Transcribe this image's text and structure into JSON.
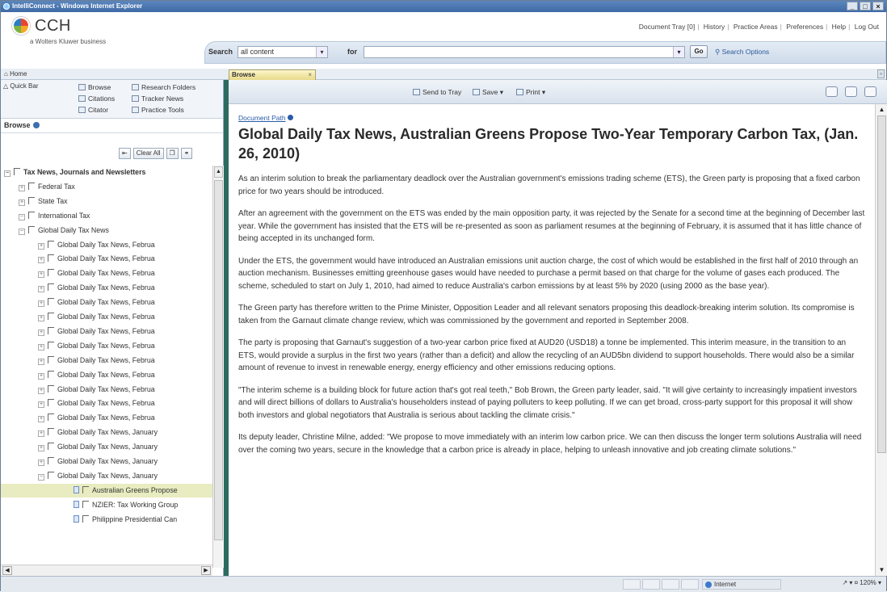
{
  "window": {
    "title": "IntelliConnect - Windows Internet Explorer",
    "controls": [
      "_",
      "□",
      "×"
    ]
  },
  "brand": {
    "name": "CCH",
    "tagline": "a Wolters Kluwer business"
  },
  "top_links": [
    "Document Tray [0]",
    "History",
    "Practice Areas",
    "Preferences",
    "Help",
    "Log Out"
  ],
  "search": {
    "label": "Search",
    "scope_value": "all content",
    "for_label": "for",
    "query_value": "",
    "go_label": "Go",
    "options_label": "Search Options"
  },
  "nav": {
    "home_label": "Home",
    "active_tab": "Browse",
    "tab_close": "×"
  },
  "quickbar": {
    "label": "Quick Bar",
    "items": [
      "Browse",
      "Research Folders",
      "Citations",
      "Tracker News",
      "Citator",
      "Practice Tools"
    ]
  },
  "browse": {
    "header": "Browse",
    "clear_all_label": "Clear All"
  },
  "tree": [
    {
      "label": "Tax News, Journals and Newsletters",
      "level": 0,
      "toggle": "−",
      "bold": true
    },
    {
      "label": "Federal Tax",
      "level": 1,
      "toggle": "+"
    },
    {
      "label": "State Tax",
      "level": 1,
      "toggle": "+"
    },
    {
      "label": "International Tax",
      "level": 1,
      "toggle": "−"
    },
    {
      "label": "Global Daily Tax News",
      "level": 2,
      "toggle": "−"
    },
    {
      "label": "Global Daily Tax News, Februa",
      "level": 3,
      "toggle": "+"
    },
    {
      "label": "Global Daily Tax News, Februa",
      "level": 3,
      "toggle": "+"
    },
    {
      "label": "Global Daily Tax News, Februa",
      "level": 3,
      "toggle": "+"
    },
    {
      "label": "Global Daily Tax News, Februa",
      "level": 3,
      "toggle": "+"
    },
    {
      "label": "Global Daily Tax News, Februa",
      "level": 3,
      "toggle": "+"
    },
    {
      "label": "Global Daily Tax News, Februa",
      "level": 3,
      "toggle": "+"
    },
    {
      "label": "Global Daily Tax News, Februa",
      "level": 3,
      "toggle": "+"
    },
    {
      "label": "Global Daily Tax News, Februa",
      "level": 3,
      "toggle": "+"
    },
    {
      "label": "Global Daily Tax News, Februa",
      "level": 3,
      "toggle": "+"
    },
    {
      "label": "Global Daily Tax News, Februa",
      "level": 3,
      "toggle": "+"
    },
    {
      "label": "Global Daily Tax News, Februa",
      "level": 3,
      "toggle": "+"
    },
    {
      "label": "Global Daily Tax News, Februa",
      "level": 3,
      "toggle": "+"
    },
    {
      "label": "Global Daily Tax News, Februa",
      "level": 3,
      "toggle": "+"
    },
    {
      "label": "Global Daily Tax News, January",
      "level": 3,
      "toggle": "+"
    },
    {
      "label": "Global Daily Tax News, January",
      "level": 3,
      "toggle": "+"
    },
    {
      "label": "Global Daily Tax News, January",
      "level": 3,
      "toggle": "+"
    },
    {
      "label": "Global Daily Tax News, January",
      "level": 3,
      "toggle": "−"
    },
    {
      "label": "Australian Greens Propose",
      "level": 4,
      "doc": true,
      "selected": true
    },
    {
      "label": "NZIER: Tax Working Group",
      "level": 4,
      "doc": true
    },
    {
      "label": "Philippine Presidential Can",
      "level": 4,
      "doc": true
    }
  ],
  "doc_toolbar": {
    "send_to_tray": "Send to Tray",
    "save": "Save ▾",
    "print": "Print ▾"
  },
  "document": {
    "path_label": "Document Path",
    "title": "Global Daily Tax News, Australian Greens Propose Two-Year Temporary Carbon Tax, (Jan. 26, 2010)",
    "paragraphs": [
      "As an interim solution to break the parliamentary deadlock over the Australian government's emissions trading scheme (ETS), the Green party is proposing that a fixed carbon price for two years should be introduced.",
      "After an agreement with the government on the ETS was ended by the main opposition party, it was rejected by the Senate for a second time at the beginning of December last year. While the government has insisted that the ETS will be re-presented as soon as parliament resumes at the beginning of February, it is assumed that it has little chance of being accepted in its unchanged form.",
      "Under the ETS, the government would have introduced an Australian emissions unit auction charge, the cost of which would be established in the first half of 2010 through an auction mechanism. Businesses emitting greenhouse gases would have needed to purchase a permit based on that charge for the volume of gases each produced. The scheme, scheduled to start on July 1, 2010, had aimed to reduce Australia's carbon emissions by at least 5% by 2020 (using 2000 as the base year).",
      "The Green party has therefore written to the Prime Minister, Opposition Leader and all relevant senators proposing this deadlock-breaking interim solution. Its compromise is taken from the Garnaut climate change review, which was commissioned by the government and reported in September 2008.",
      "The party is proposing that Garnaut's suggestion of a two-year carbon price fixed at AUD20 (USD18) a tonne be implemented. This interim measure, in the transition to an ETS, would provide a surplus in the first two years (rather than a deficit) and allow the recycling of an AUD5bn dividend to support households. There would also be a similar amount of revenue to invest in renewable energy, energy efficiency and other emissions reducing options.",
      "\"The interim scheme is a building block for future action that's got real teeth,\" Bob Brown, the Green party leader, said. \"It will give certainty to increasingly impatient investors and will direct billions of dollars to Australia's householders instead of paying polluters to keep polluting. If we can get broad, cross-party support for this proposal it will show both investors and global negotiators that Australia is serious about tackling the climate crisis.\"",
      "Its deputy leader, Christine Milne, added: \"We propose to move immediately with an interim low carbon price. We can then discuss the longer term solutions Australia will need over the coming two years, secure in the knowledge that a carbon price is already in place, helping to unleash innovative and job creating climate solutions.\""
    ]
  },
  "status": {
    "zone": "Internet",
    "zoom": "↗ ▾  ¤ 120% ▾"
  }
}
